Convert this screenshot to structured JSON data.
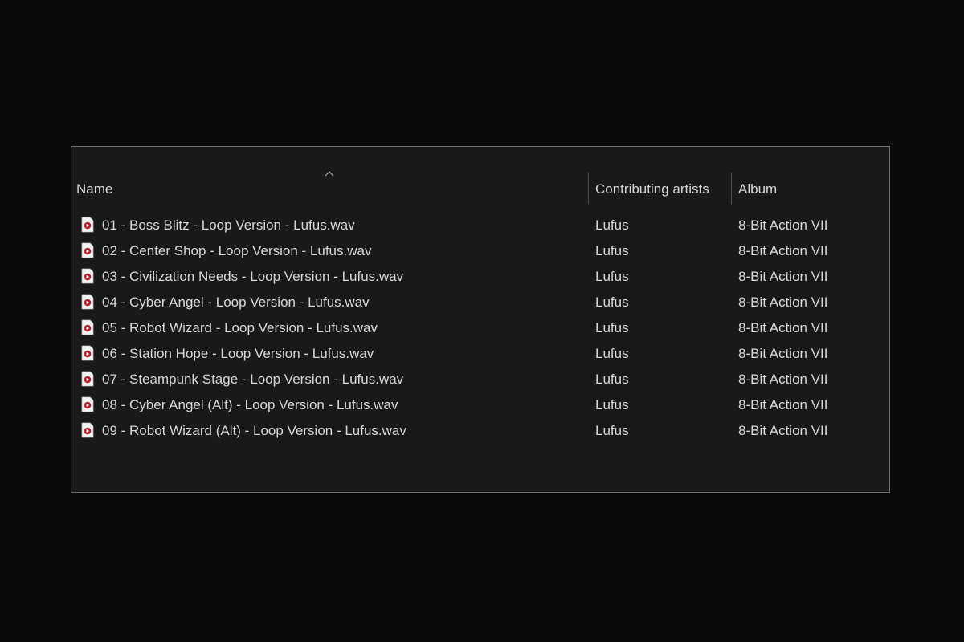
{
  "columns": {
    "name": "Name",
    "artists": "Contributing artists",
    "album": "Album"
  },
  "sort": {
    "column": "name",
    "direction": "ascending",
    "icon": "chevron-up-icon"
  },
  "file_icon": "audio-file-icon",
  "files": [
    {
      "name": "01 - Boss Blitz - Loop Version - Lufus.wav",
      "artist": "Lufus",
      "album": "8-Bit Action VII"
    },
    {
      "name": "02 - Center Shop - Loop Version - Lufus.wav",
      "artist": "Lufus",
      "album": "8-Bit Action VII"
    },
    {
      "name": "03 - Civilization Needs - Loop Version - Lufus.wav",
      "artist": "Lufus",
      "album": "8-Bit Action VII"
    },
    {
      "name": "04 - Cyber Angel - Loop Version - Lufus.wav",
      "artist": "Lufus",
      "album": "8-Bit Action VII"
    },
    {
      "name": "05 - Robot Wizard - Loop Version - Lufus.wav",
      "artist": "Lufus",
      "album": "8-Bit Action VII"
    },
    {
      "name": "06 - Station Hope - Loop Version - Lufus.wav",
      "artist": "Lufus",
      "album": "8-Bit Action VII"
    },
    {
      "name": "07 - Steampunk Stage - Loop Version - Lufus.wav",
      "artist": "Lufus",
      "album": "8-Bit Action VII"
    },
    {
      "name": "08 - Cyber Angel (Alt) - Loop Version - Lufus.wav",
      "artist": "Lufus",
      "album": "8-Bit Action VII"
    },
    {
      "name": "09 - Robot Wizard (Alt) - Loop Version - Lufus.wav",
      "artist": "Lufus",
      "album": "8-Bit Action VII"
    }
  ]
}
